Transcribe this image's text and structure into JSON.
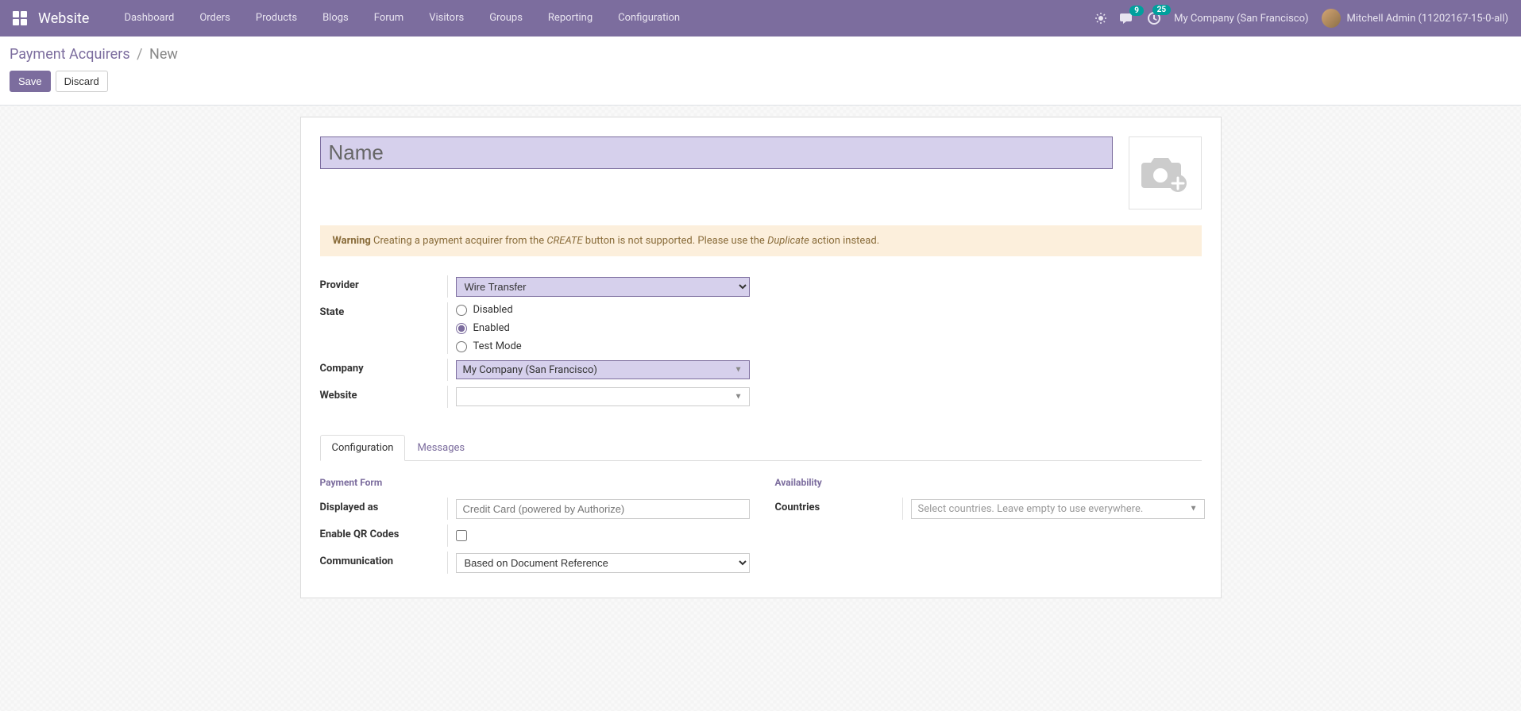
{
  "navbar": {
    "brand": "Website",
    "items": [
      "Dashboard",
      "Orders",
      "Products",
      "Blogs",
      "Forum",
      "Visitors",
      "Groups",
      "Reporting",
      "Configuration"
    ],
    "messages_badge": "9",
    "activities_badge": "25",
    "company": "My Company (San Francisco)",
    "user": "Mitchell Admin (11202167-15-0-all)"
  },
  "breadcrumb": {
    "parent": "Payment Acquirers",
    "current": "New"
  },
  "buttons": {
    "save": "Save",
    "discard": "Discard"
  },
  "form": {
    "name_placeholder": "Name",
    "warning_label": "Warning",
    "warning_text1": " Creating a payment acquirer from the ",
    "warning_create": "CREATE",
    "warning_text2": " button is not supported. Please use the ",
    "warning_dup": "Duplicate",
    "warning_text3": " action instead.",
    "labels": {
      "provider": "Provider",
      "state": "State",
      "company": "Company",
      "website": "Website"
    },
    "provider_value": "Wire Transfer",
    "state_options": {
      "disabled": "Disabled",
      "enabled": "Enabled",
      "test": "Test Mode"
    },
    "state_selected": "enabled",
    "company_value": "My Company (San Francisco)",
    "website_value": ""
  },
  "tabs": {
    "configuration": "Configuration",
    "messages": "Messages"
  },
  "config_tab": {
    "section_payment_form": "Payment Form",
    "section_availability": "Availability",
    "labels": {
      "displayed_as": "Displayed as",
      "enable_qr": "Enable QR Codes",
      "communication": "Communication",
      "countries": "Countries"
    },
    "displayed_as_placeholder": "Credit Card (powered by Authorize)",
    "communication_value": "Based on Document Reference",
    "countries_placeholder": "Select countries. Leave empty to use everywhere."
  }
}
